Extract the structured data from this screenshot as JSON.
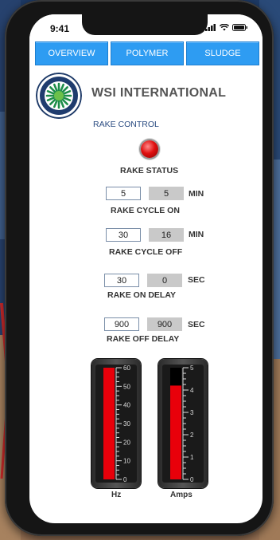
{
  "status_bar": {
    "time": "9:41"
  },
  "tabs": [
    {
      "label": "OVERVIEW"
    },
    {
      "label": "POLYMER"
    },
    {
      "label": "SLUDGE"
    }
  ],
  "company": "WSI INTERNATIONAL",
  "section_title": "RAKE CONTROL",
  "rake_status": {
    "label": "RAKE STATUS",
    "state": "on",
    "color": "#e01010"
  },
  "settings": [
    {
      "label": "RAKE CYCLE ON",
      "setpoint": "5",
      "actual": "5",
      "unit": "MIN"
    },
    {
      "label": "RAKE CYCLE OFF",
      "setpoint": "30",
      "actual": "16",
      "unit": "MIN"
    },
    {
      "label": "RAKE ON DELAY",
      "setpoint": "30",
      "actual": "0",
      "unit": "SEC"
    },
    {
      "label": "RAKE OFF DELAY",
      "setpoint": "900",
      "actual": "900",
      "unit": "SEC"
    }
  ],
  "gauges": [
    {
      "label": "Hz",
      "min": 0,
      "max": 60,
      "major_ticks": [
        "0",
        "10",
        "20",
        "30",
        "40",
        "50",
        "60"
      ],
      "value": 60
    },
    {
      "label": "Amps",
      "min": 0,
      "max": 5,
      "major_ticks": [
        "0",
        "1",
        "2",
        "3",
        "4",
        "5"
      ],
      "value": 4.2
    }
  ],
  "colors": {
    "tab": "#2e9cf2",
    "fill": "#e8000a",
    "section": "#2b4c82"
  }
}
